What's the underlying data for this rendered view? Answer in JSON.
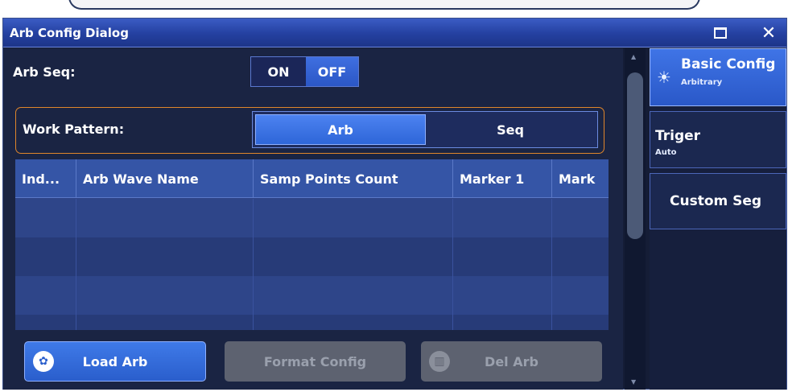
{
  "dialog": {
    "title": "Arb Config Dialog"
  },
  "arb_seq": {
    "label": "Arb Seq:",
    "on_label": "ON",
    "off_label": "OFF",
    "selected": "OFF"
  },
  "work_pattern": {
    "label": "Work Pattern:",
    "options": [
      "Arb",
      "Seq"
    ],
    "selected": "Arb"
  },
  "table": {
    "columns": [
      "Ind...",
      "Arb Wave Name",
      "Samp Points Count",
      "Marker 1",
      "Mark"
    ],
    "rows": []
  },
  "buttons": {
    "load": "Load Arb",
    "format": "Format Config",
    "delete": "Del Arb"
  },
  "side_tabs": [
    {
      "label": "Basic Config",
      "sub": "Arbitrary"
    },
    {
      "label": "Triger",
      "sub": "Auto"
    },
    {
      "label": "Custom Seg",
      "sub": ""
    }
  ],
  "colors": {
    "accent": "#2e66d8",
    "highlight_border": "#e0862a",
    "disabled": "#5d6270"
  }
}
